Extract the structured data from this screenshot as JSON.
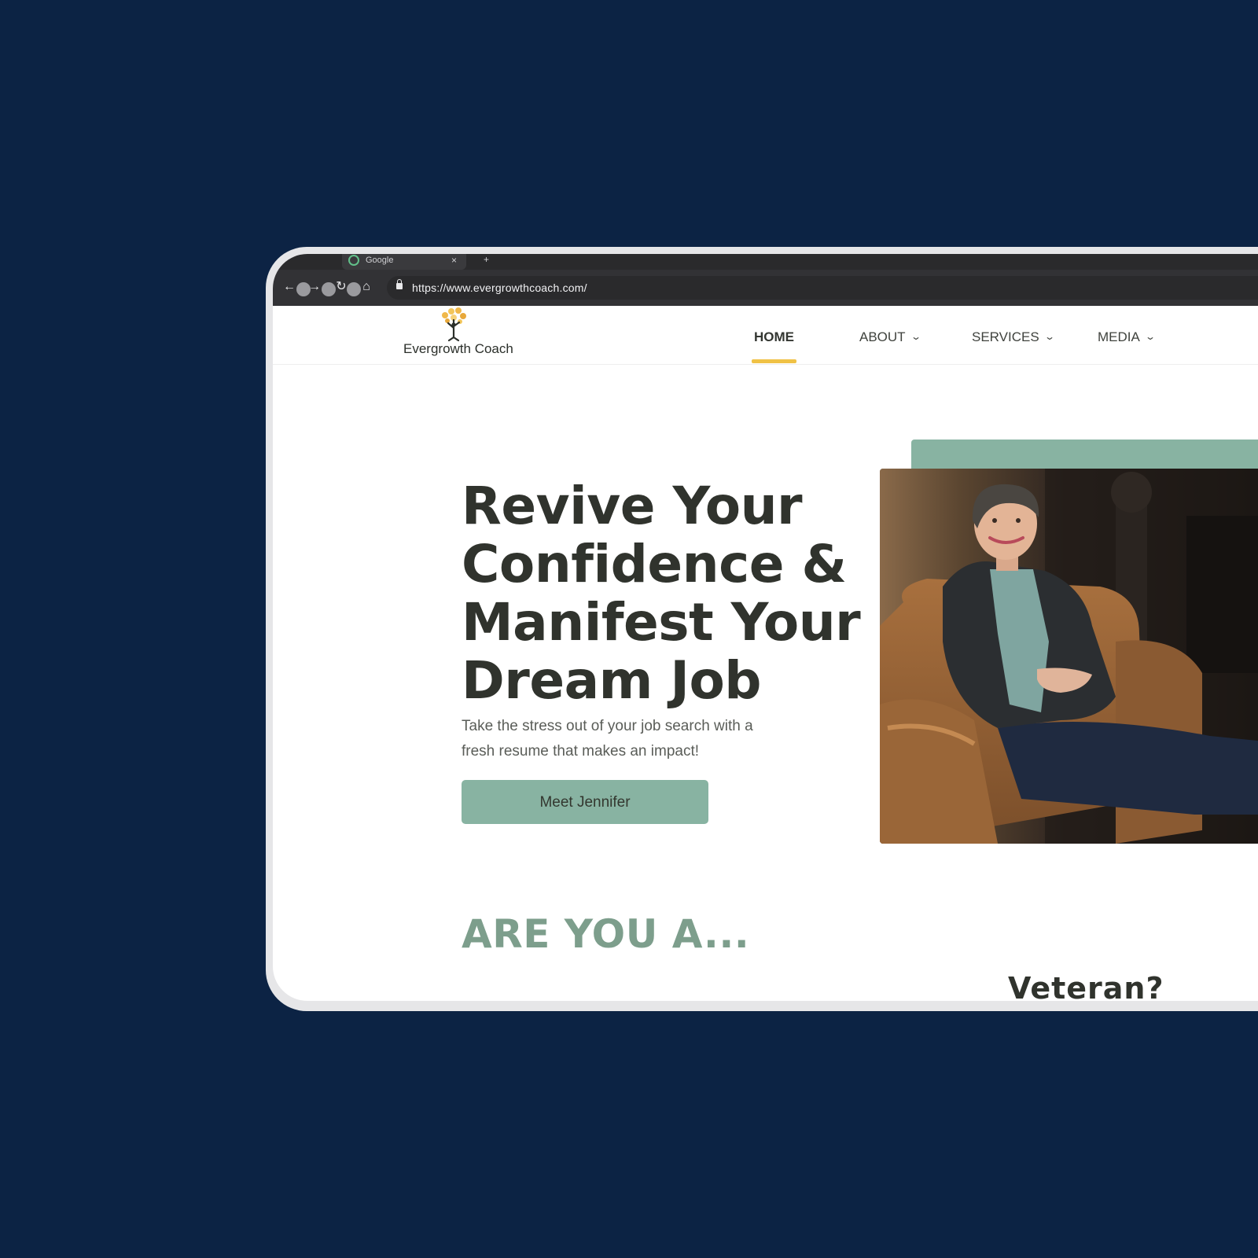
{
  "browser": {
    "tab_title": "Google",
    "tab_close": "×",
    "tab_new": "+",
    "url": "https://www.evergrowthcoach.com/"
  },
  "site": {
    "logo_text": "Evergrowth Coach",
    "nav": [
      {
        "label": "HOME",
        "active": true
      },
      {
        "label": "ABOUT",
        "dropdown": true
      },
      {
        "label": "SERVICES",
        "dropdown": true
      },
      {
        "label": "MEDIA",
        "dropdown": true
      }
    ]
  },
  "hero": {
    "title_lines": [
      "Revive Your",
      "Confidence &",
      "Manifest Your",
      "Dream Job"
    ],
    "subtitle_lines": [
      "Take the stress out of your job search with a",
      "fresh resume that makes an impact!"
    ],
    "cta_label": "Meet Jennifer"
  },
  "sections": {
    "are_you_title": "ARE YOU A...",
    "next_heading": "Veteran?"
  },
  "colors": {
    "page_background": "#0c2344",
    "accent_green": "#88b3a2",
    "accent_yellow": "#f0c246",
    "heading_dark": "#30332d",
    "section_green": "#7d9e8c"
  },
  "icons": {
    "back": "arrow-left-icon",
    "forward": "arrow-right-icon",
    "reload": "reload-icon",
    "home": "home-icon",
    "lock": "lock-icon",
    "chevron": "chevron-down-icon"
  }
}
